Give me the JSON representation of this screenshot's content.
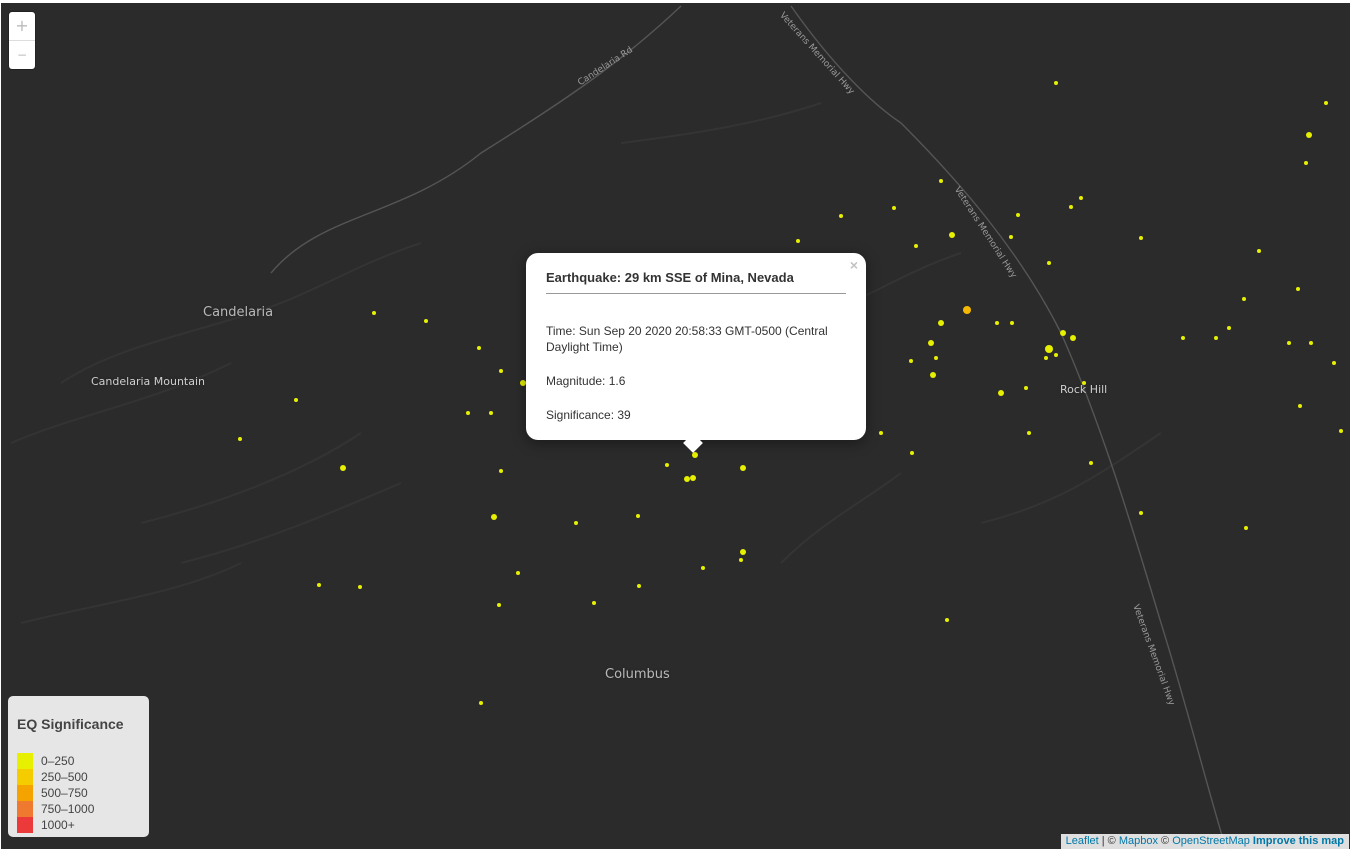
{
  "map": {
    "zoom_in_label": "+",
    "zoom_out_label": "−",
    "places": {
      "candelaria": "Candelaria",
      "candelaria_mountain": "Candelaria Mountain",
      "columbus": "Columbus",
      "rock_hill": "Rock Hill"
    },
    "roads": {
      "candelaria_rd": "Candelaria Rd",
      "hwy_1": "Veterans Memorial Hwy",
      "hwy_2": "Veterans Memorial Hwy",
      "hwy_3": "Veterans Memorial Hwy"
    },
    "marker_color_default": "#e6f000",
    "marker_color_medium": "#f5b800"
  },
  "popup": {
    "title": "Earthquake: 29 km SSE of Mina, Nevada",
    "close": "×",
    "time": "Time: Sun Sep 20 2020 20:58:33 GMT-0500 (Central Daylight Time)",
    "magnitude": "Magnitude: 1.6",
    "significance": "Significance: 39"
  },
  "legend": {
    "title": "EQ Significance",
    "items": [
      {
        "label": "0–250",
        "color": "#e6f000"
      },
      {
        "label": "250–500",
        "color": "#f5cc00"
      },
      {
        "label": "500–750",
        "color": "#f5a300"
      },
      {
        "label": "750–1000",
        "color": "#ef7a2f"
      },
      {
        "label": "1000+",
        "color": "#ec3a3a"
      }
    ]
  },
  "attribution": {
    "leaflet": "Leaflet",
    "sep1": " | © ",
    "mapbox": "Mapbox",
    "sep2": " © ",
    "osm": "OpenStreetMap",
    "improve": "Improve this map"
  }
}
